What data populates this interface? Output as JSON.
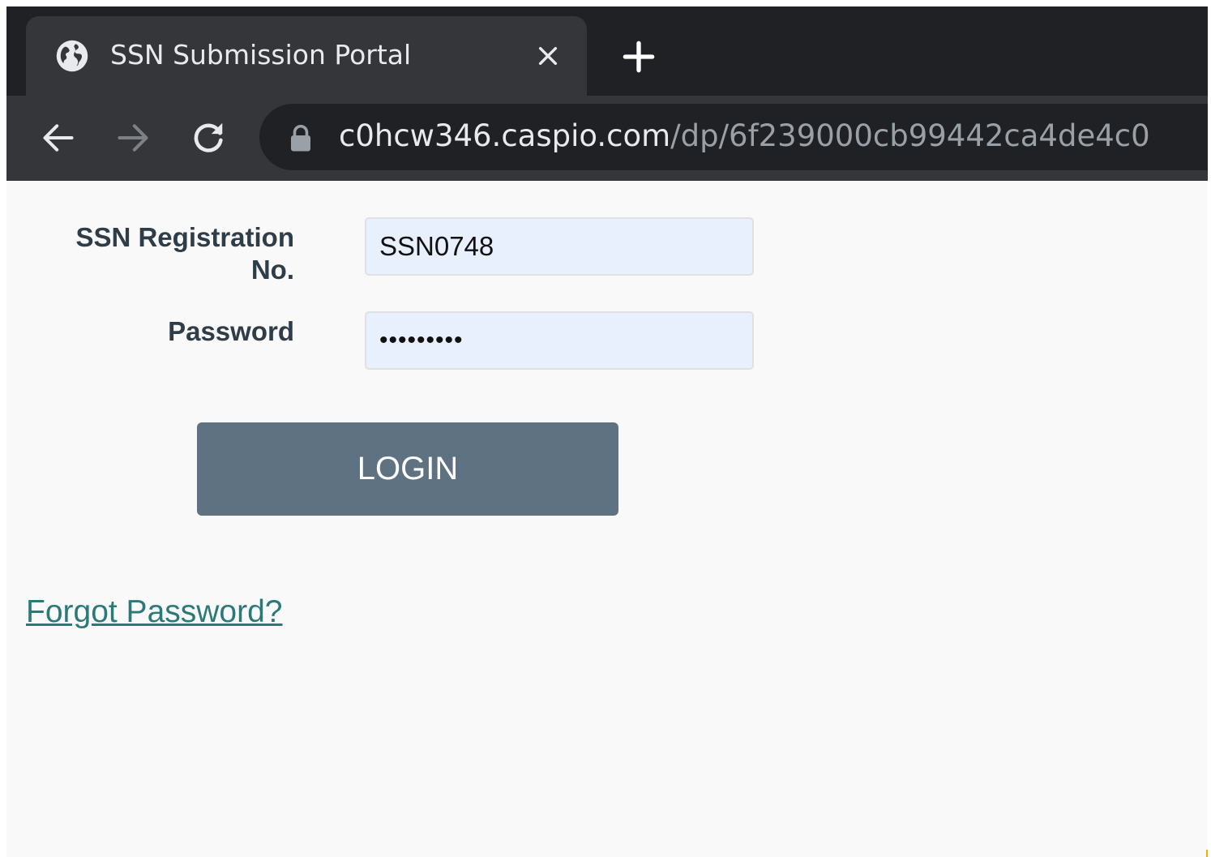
{
  "browser": {
    "tab": {
      "title": "SSN Submission Portal",
      "favicon": "globe-icon",
      "close_icon": "close-icon"
    },
    "new_tab_icon": "plus-icon",
    "nav": {
      "back_icon": "arrow-left-icon",
      "forward_icon": "arrow-right-icon",
      "reload_icon": "reload-icon"
    },
    "address_bar": {
      "lock_icon": "lock-icon",
      "host": "c0hcw346.caspio.com",
      "path": "/dp/6f239000cb99442ca4de4c0"
    }
  },
  "form": {
    "ssn_label": "SSN Registration No.",
    "ssn_value": "SSN0748",
    "password_label": "Password",
    "password_value": "•••••••••",
    "login_label": "LOGIN",
    "forgot_label": "Forgot Password?"
  },
  "colors": {
    "chrome_dark": "#202124",
    "chrome_tab": "#35363a",
    "field_bg": "#e8f0fe",
    "button_bg": "#5f7282",
    "link": "#2b7a78",
    "label_text": "#2f3d48"
  }
}
